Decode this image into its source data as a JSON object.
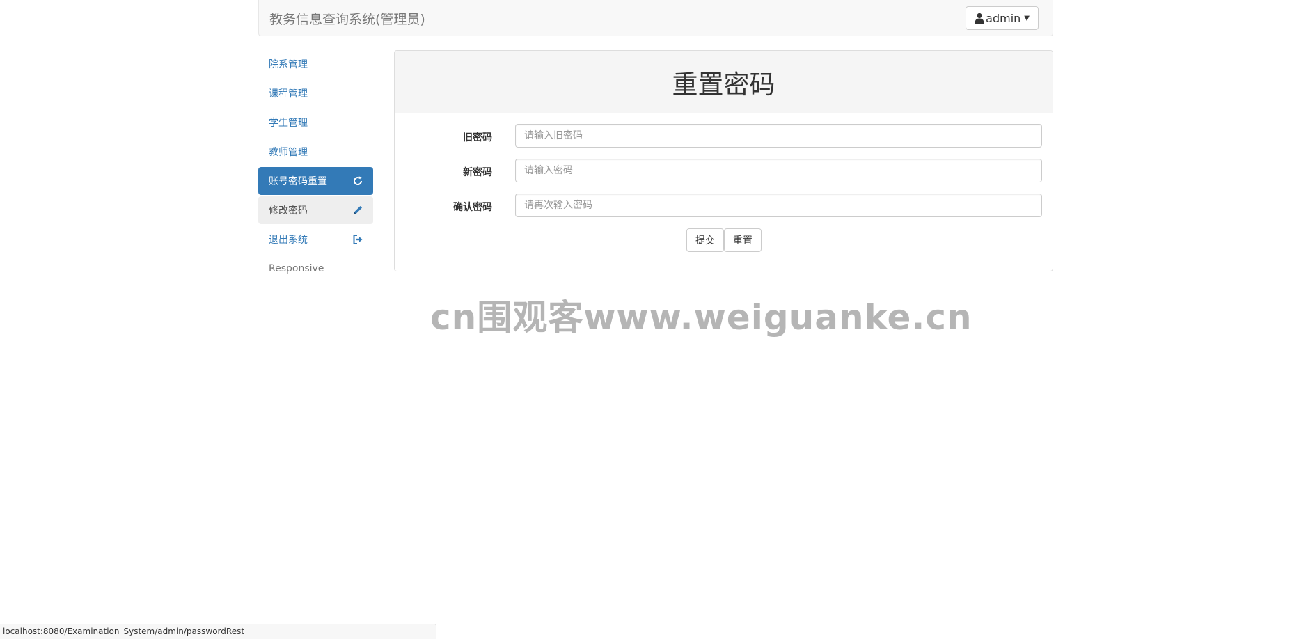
{
  "navbar": {
    "brand": "教务信息查询系统(管理员)",
    "user_label": "admin"
  },
  "sidebar": {
    "items": [
      {
        "label": "院系管理"
      },
      {
        "label": "课程管理"
      },
      {
        "label": "学生管理"
      },
      {
        "label": "教师管理"
      },
      {
        "label": "账号密码重置",
        "icon": "refresh-icon",
        "state": "active"
      },
      {
        "label": "修改密码",
        "icon": "pencil-icon",
        "state": "hover"
      },
      {
        "label": "退出系统",
        "icon": "logout-icon"
      },
      {
        "label": "Responsive"
      }
    ]
  },
  "panel": {
    "title": "重置密码",
    "fields": [
      {
        "label": "旧密码",
        "placeholder": "请输入旧密码"
      },
      {
        "label": "新密码",
        "placeholder": "请输入密码"
      },
      {
        "label": "确认密码",
        "placeholder": "请再次输入密码"
      }
    ],
    "submit_label": "提交",
    "reset_label": "重置"
  },
  "watermark": "cn围观客www.weiguanke.cn",
  "statusbar": {
    "url": "localhost:8080/Examination_System/admin/passwordRest"
  },
  "colors": {
    "primary": "#337ab7",
    "navbar_bg": "#f8f8f8",
    "panel_heading_bg": "#f5f5f5",
    "watermark": "#b5b5b5"
  }
}
